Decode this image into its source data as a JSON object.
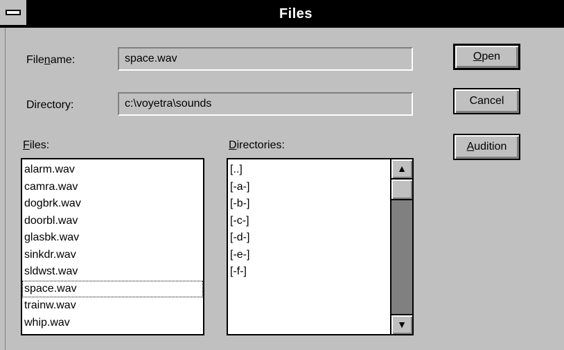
{
  "window": {
    "title": "Files"
  },
  "form": {
    "filename_label_pre": "File",
    "filename_label_u": "n",
    "filename_label_post": "ame:",
    "filename_value": "space.wav",
    "directory_label": "Directory:",
    "directory_value": "c:\\voyetra\\sounds"
  },
  "files": {
    "label_u": "F",
    "label_rest": "iles:",
    "items": [
      "alarm.wav",
      "camra.wav",
      "dogbrk.wav",
      "doorbl.wav",
      "glasbk.wav",
      "sinkdr.wav",
      "sldwst.wav",
      "space.wav",
      "trainw.wav",
      "whip.wav"
    ],
    "focused_item": "space.wav"
  },
  "directories": {
    "label_u": "D",
    "label_rest": "irectories:",
    "items": [
      "[..]",
      "[-a-]",
      "[-b-]",
      "[-c-]",
      "[-d-]",
      "[-e-]",
      "[-f-]"
    ]
  },
  "buttons": {
    "open_u": "O",
    "open_rest": "pen",
    "cancel": "Cancel",
    "audition_u": "A",
    "audition_rest": "udition"
  },
  "icons": {
    "system_menu": "system-menu-icon",
    "scroll_up": "arrow-up-icon",
    "scroll_down": "arrow-down-icon"
  }
}
